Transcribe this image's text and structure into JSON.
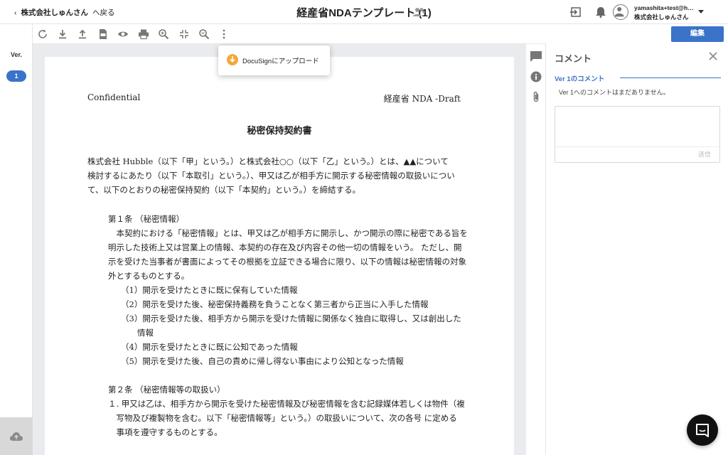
{
  "header": {
    "back_org": "株式会社しゅんさん",
    "back_label": "へ戻る",
    "title": "経産省NDAテンプレート (1)",
    "user_email": "yamashita+test@hubble-docs.com",
    "user_org": "株式会社しゅんさん"
  },
  "left_rail": {
    "ver_label": "Ver.",
    "versions": [
      "1"
    ]
  },
  "toolbar": {
    "icons": [
      "refresh-icon",
      "download-icon",
      "upload-icon",
      "pdf-icon",
      "preview-icon",
      "print-icon",
      "zoom-in-icon",
      "fit-icon",
      "zoom-out-icon",
      "more-icon"
    ],
    "edit_label": "編集"
  },
  "popup": {
    "label": "DocuSignにアップロード"
  },
  "document": {
    "confidential": "Confidential",
    "draft": "経産省 NDA -Draft",
    "title": "秘密保持契約書",
    "intro": [
      "株式会社 Hubble（以下「甲」という。）と株式会社○○（以下「乙」という。）とは、▲▲について",
      "検討するにあたり（以下「本取引」という。）、甲又は乙が相手方に開示する秘密情報の取扱いについ",
      "て、以下のとおりの秘密保持契約（以下「本契約」という。）を締結する。"
    ],
    "art1_title": "第１条 （秘密情報）",
    "art1_body": [
      "　本契約における「秘密情報」とは、甲又は乙が相手方に開示し、かつ開示の際に秘密である旨を",
      "明示した技術上又は営業上の情報、本契約の存在及び内容その他一切の情報をいう。 ただし、開",
      "示を受けた当事者が書面によってその根拠を立証できる場合に限り、以下の情報は秘密情報の対象",
      "外とするものとする。"
    ],
    "art1_items": [
      "（1）開示を受けたときに既に保有していた情報",
      "（2）開示を受けた後、秘密保持義務を負うことなく第三者から正当に入手した情報",
      "（3）開示を受けた後、相手方から開示を受けた情報に関係なく独自に取得し、又は創出した",
      "　　情報",
      "（4）開示を受けたときに既に公知であった情報",
      "（5）開示を受けた後、自己の責めに帰し得ない事由により公知となった情報"
    ],
    "art2_title": "第２条 （秘密情報等の取扱い）",
    "art2_body": [
      "１. 甲又は乙は、相手方から開示を受けた秘密情報及び秘密情報を含む記録媒体若しくは物件（複",
      "　写物及び複製物を含む。以下「秘密情報等」という。）の取扱いについて、次の各号 に定める",
      "　事項を遵守するものとする。"
    ]
  },
  "comments": {
    "title": "コメント",
    "ver_heading": "Ver 1のコメント",
    "empty": "Ver 1へのコメントはまだありません。",
    "input_placeholder": "",
    "send_label": "送信"
  }
}
